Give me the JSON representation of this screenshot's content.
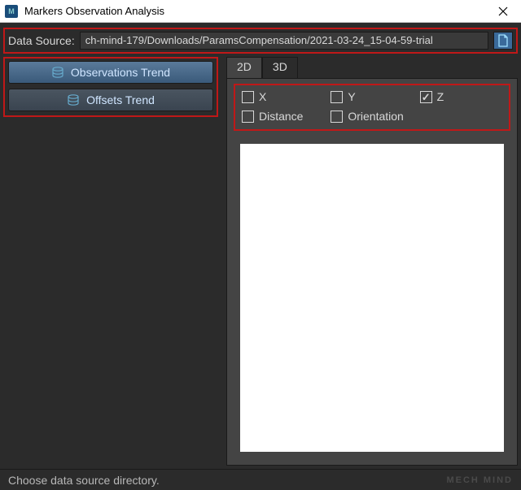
{
  "window": {
    "title": "Markers Observation Analysis"
  },
  "datasource": {
    "label": "Data Source:",
    "path": "ch-mind-179/Downloads/ParamsCompensation/2021-03-24_15-04-59-trial"
  },
  "sidebar": {
    "buttons": [
      {
        "label": "Observations Trend",
        "active": true
      },
      {
        "label": "Offsets Trend",
        "active": false
      }
    ]
  },
  "tabs": {
    "items": [
      {
        "label": "2D",
        "active": true
      },
      {
        "label": "3D",
        "active": false
      }
    ]
  },
  "checks": {
    "x": {
      "label": "X",
      "checked": false
    },
    "y": {
      "label": "Y",
      "checked": false
    },
    "z": {
      "label": "Z",
      "checked": true
    },
    "distance": {
      "label": "Distance",
      "checked": false
    },
    "orientation": {
      "label": "Orientation",
      "checked": false
    }
  },
  "status": {
    "text": "Choose data source directory.",
    "brand": "MECH MIND"
  }
}
